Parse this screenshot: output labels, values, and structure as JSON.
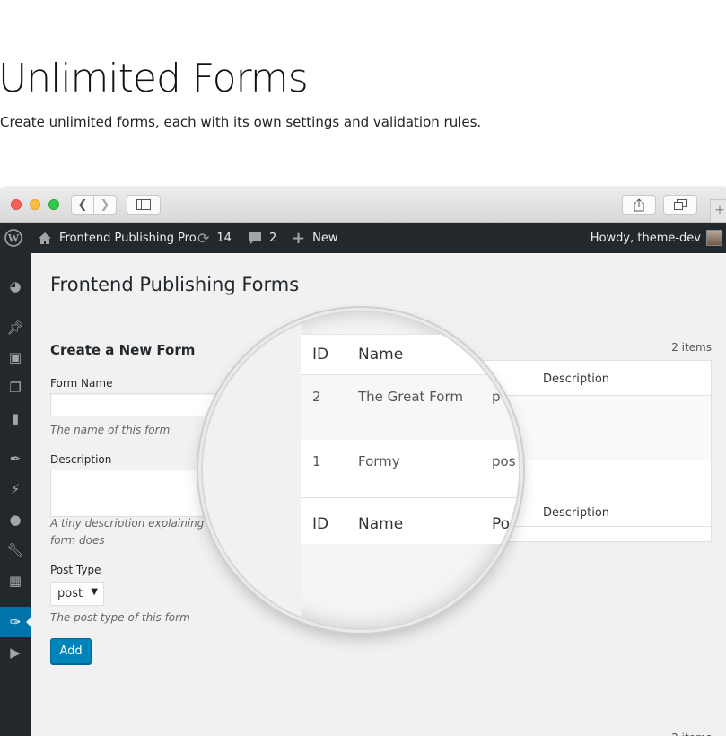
{
  "hero": {
    "title": "Unlimited Forms",
    "subtitle": "Create unlimited forms, each with its own settings and validation rules."
  },
  "adminbar": {
    "site_name": "Frontend Publishing Pro",
    "updates_count": "14",
    "comments_count": "2",
    "new_label": "New",
    "howdy": "Howdy, theme-dev"
  },
  "page": {
    "title": "Frontend Publishing Forms"
  },
  "form": {
    "heading": "Create a New Form",
    "name_label": "Form Name",
    "name_help": "The name of this form",
    "description_label": "Description",
    "description_help_line1": "A tiny description explaining what this",
    "description_help_line2": "form does",
    "post_type_label": "Post Type",
    "post_type_value": "post",
    "post_type_help": "The post type of this form",
    "add_button": "Add"
  },
  "table": {
    "count": "2 items",
    "columns": [
      "ID",
      "Name",
      "Post Type",
      "Description"
    ],
    "rows": [
      {
        "id": "2",
        "name": "The Great Form",
        "post_type": "post",
        "description": ""
      },
      {
        "id": "1",
        "name": "Formy",
        "post_type": "post",
        "description": ""
      }
    ]
  },
  "magnifier": {
    "header_id": "ID",
    "header_name": "Name",
    "row1_id": "2",
    "row1_name": "The Great Form",
    "row1_type_fragment": "p",
    "row2_id": "1",
    "row2_name": "Formy",
    "row2_type_fragment": "pos",
    "footer_id": "ID",
    "footer_name": "Name",
    "footer_type_fragment": "Po"
  },
  "colors": {
    "admin_dark": "#23282d",
    "accent": "#0073aa",
    "button": "#0085ba"
  }
}
